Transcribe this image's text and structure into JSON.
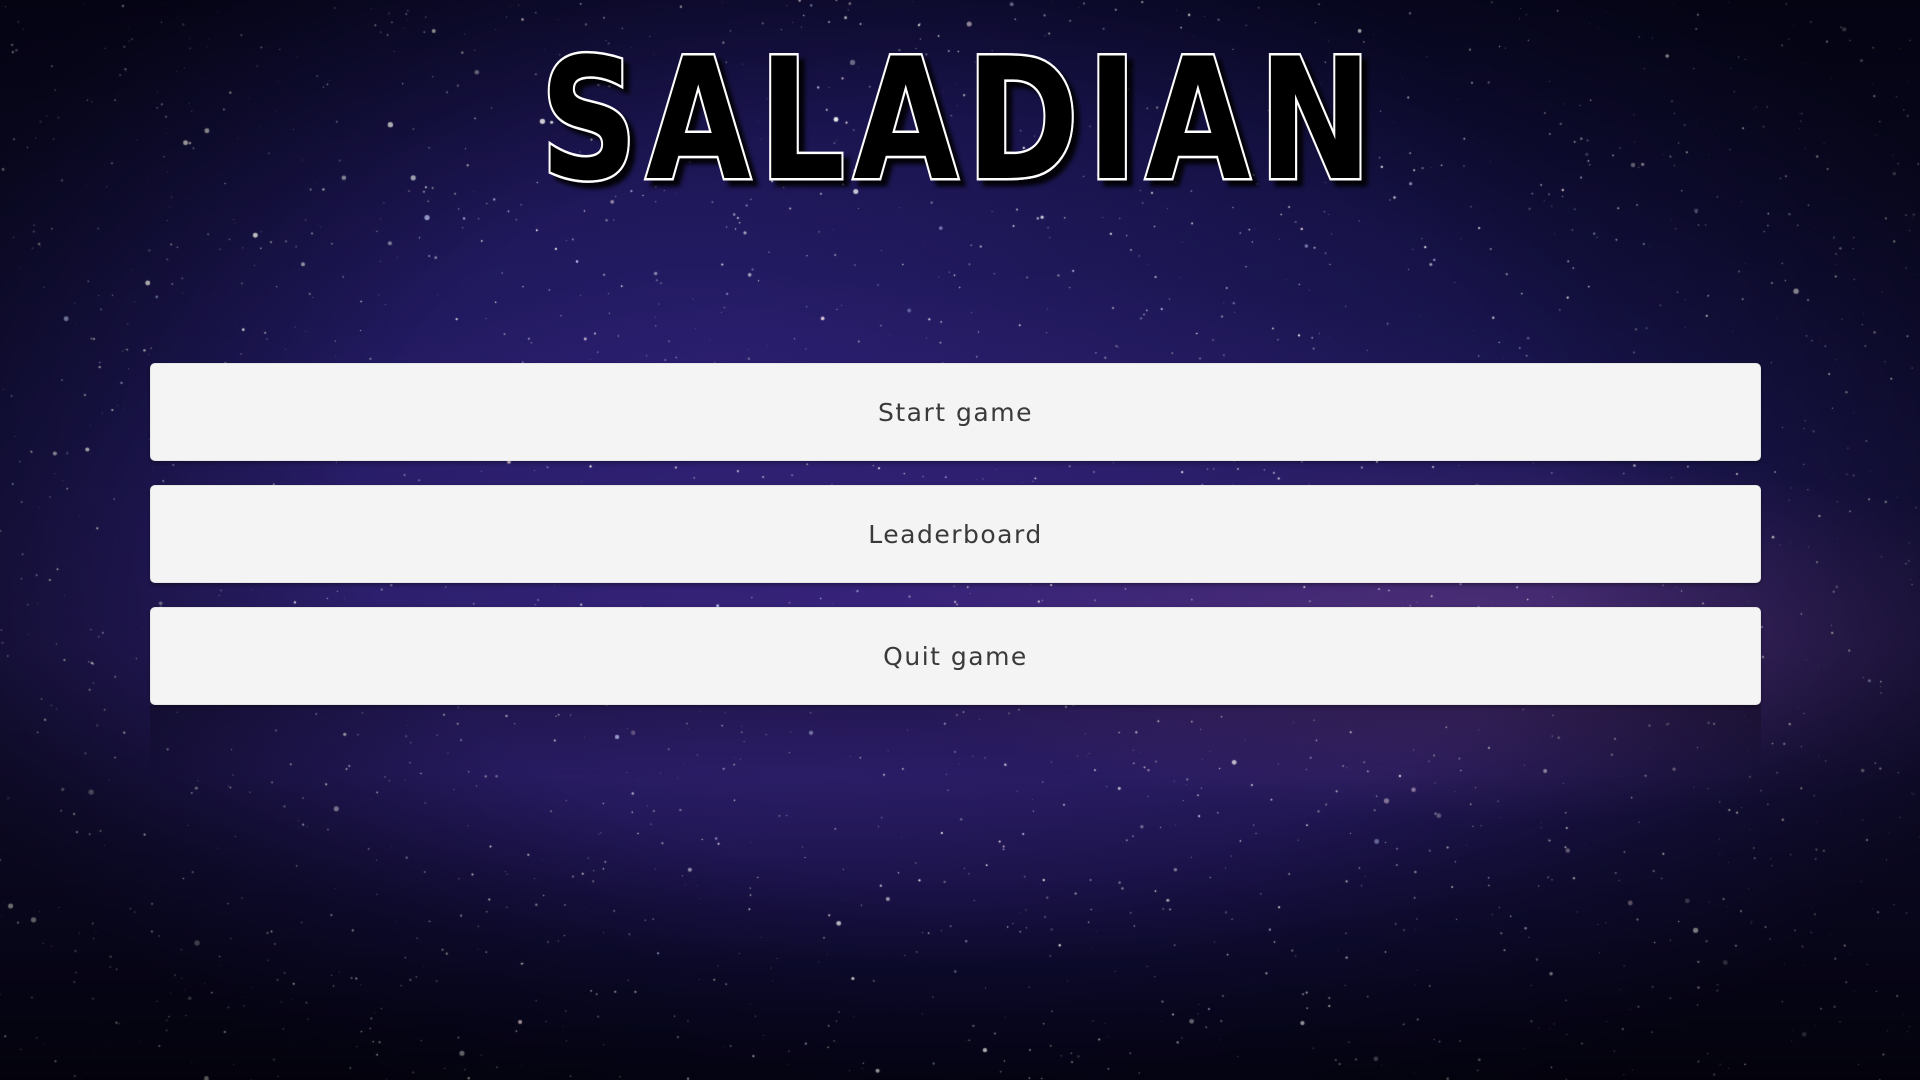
{
  "game": {
    "title": "SALADIAN"
  },
  "menu": {
    "items": [
      {
        "label": "Start game"
      },
      {
        "label": "Leaderboard"
      },
      {
        "label": "Quit game"
      }
    ]
  },
  "colors": {
    "button_background": "#f4f4f4",
    "button_text": "#3a3a3a",
    "title_fill": "#000000",
    "title_outline": "#ffffff",
    "space_background": "#1a1650"
  },
  "icons": {
    "background": "starfield-background"
  }
}
